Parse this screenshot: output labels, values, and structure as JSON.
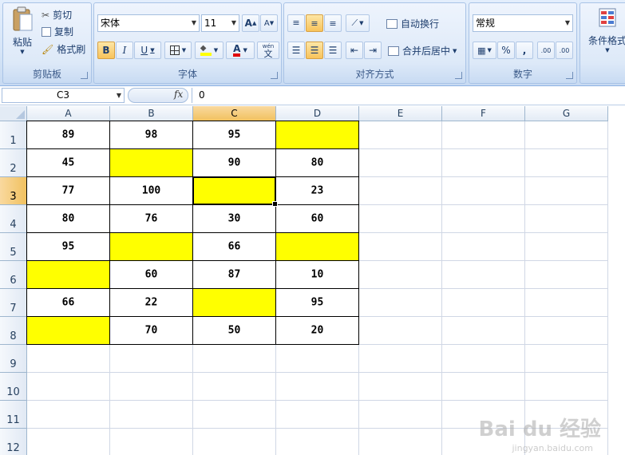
{
  "ribbon": {
    "clipboard": {
      "paste": "粘贴",
      "cut": "剪切",
      "copy": "复制",
      "format_painter": "格式刷",
      "label": "剪贴板"
    },
    "font": {
      "font_name": "宋体",
      "font_size": "11",
      "grow": "A",
      "shrink": "A",
      "bold": "B",
      "italic": "I",
      "underline": "U",
      "font_color_glyph": "A",
      "phonetic": "文",
      "phonetic_top": "wén",
      "label": "字体"
    },
    "alignment": {
      "wrap_text": "自动换行",
      "merge_center": "合并后居中",
      "label": "对齐方式"
    },
    "number": {
      "format": "常规",
      "percent": "%",
      "comma": ",",
      "inc_decimal": ".00",
      "dec_decimal": ".00",
      "label": "数字"
    },
    "styles": {
      "conditional_format": "条件格式"
    }
  },
  "formula_bar": {
    "name_box": "C3",
    "fx": "fx",
    "content": "0"
  },
  "columns": [
    "A",
    "B",
    "C",
    "D",
    "E",
    "F",
    "G"
  ],
  "rows": [
    "1",
    "2",
    "3",
    "4",
    "5",
    "6",
    "7",
    "8",
    "9",
    "10",
    "11",
    "12"
  ],
  "selected": {
    "column": "C",
    "row": "3"
  },
  "cells": [
    [
      {
        "v": "89"
      },
      {
        "v": "98"
      },
      {
        "v": "95"
      },
      {
        "v": "",
        "y": true
      }
    ],
    [
      {
        "v": "45"
      },
      {
        "v": "",
        "y": true
      },
      {
        "v": "90"
      },
      {
        "v": "80"
      }
    ],
    [
      {
        "v": "77"
      },
      {
        "v": "100"
      },
      {
        "v": "",
        "y": true
      },
      {
        "v": "23"
      }
    ],
    [
      {
        "v": "80"
      },
      {
        "v": "76"
      },
      {
        "v": "30"
      },
      {
        "v": "60"
      }
    ],
    [
      {
        "v": "95"
      },
      {
        "v": "",
        "y": true
      },
      {
        "v": "66"
      },
      {
        "v": "",
        "y": true
      }
    ],
    [
      {
        "v": "",
        "y": true
      },
      {
        "v": "60"
      },
      {
        "v": "87"
      },
      {
        "v": "10"
      }
    ],
    [
      {
        "v": "66"
      },
      {
        "v": "22"
      },
      {
        "v": "",
        "y": true
      },
      {
        "v": "95"
      }
    ],
    [
      {
        "v": "",
        "y": true
      },
      {
        "v": "70"
      },
      {
        "v": "50"
      },
      {
        "v": "20"
      }
    ]
  ],
  "colors": {
    "highlight": "#ffff00",
    "selected_header": "#f1c15f"
  },
  "watermark": {
    "brand": "Bai du 经验",
    "site": "jingyan.baidu.com"
  }
}
